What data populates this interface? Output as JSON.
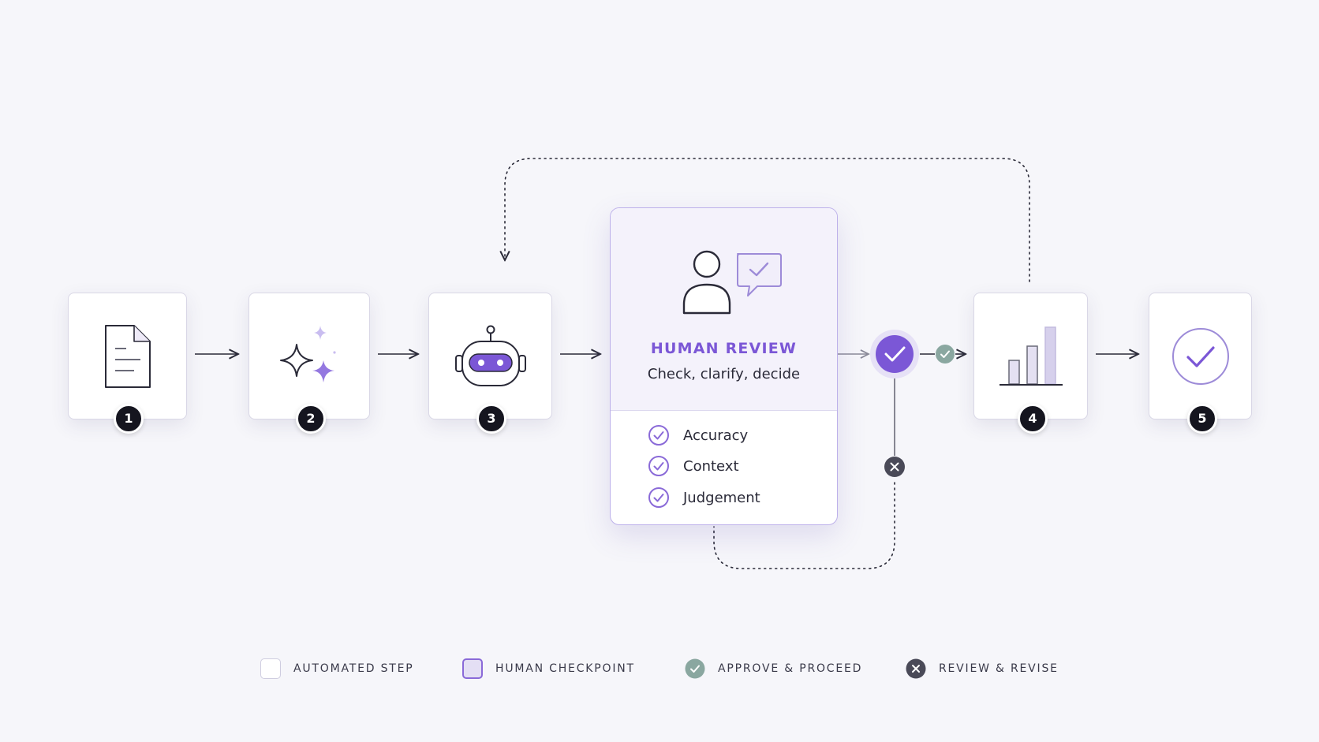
{
  "steps": [
    {
      "number": "1",
      "icon": "document-icon"
    },
    {
      "number": "2",
      "icon": "sparkles-icon"
    },
    {
      "number": "3",
      "icon": "robot-icon"
    },
    {
      "number": "4",
      "icon": "bar-chart-icon"
    },
    {
      "number": "5",
      "icon": "check-circle-icon"
    }
  ],
  "human_review": {
    "title": "HUMAN REVIEW",
    "subtitle": "Check, clarify, decide",
    "icon": "person-chat-check-icon",
    "criteria": [
      "Accuracy",
      "Context",
      "Judgement"
    ]
  },
  "legend": {
    "automated": "AUTOMATED STEP",
    "human": "HUMAN CHECKPOINT",
    "approve": "APPROVE & PROCEED",
    "revise": "REVIEW & REVISE"
  },
  "colors": {
    "accent_purple": "#7b57d6",
    "approve_teal": "#8aa7a0",
    "revise_dark": "#4a4a58",
    "badge_dark": "#15151f",
    "background": "#f6f6fa"
  }
}
